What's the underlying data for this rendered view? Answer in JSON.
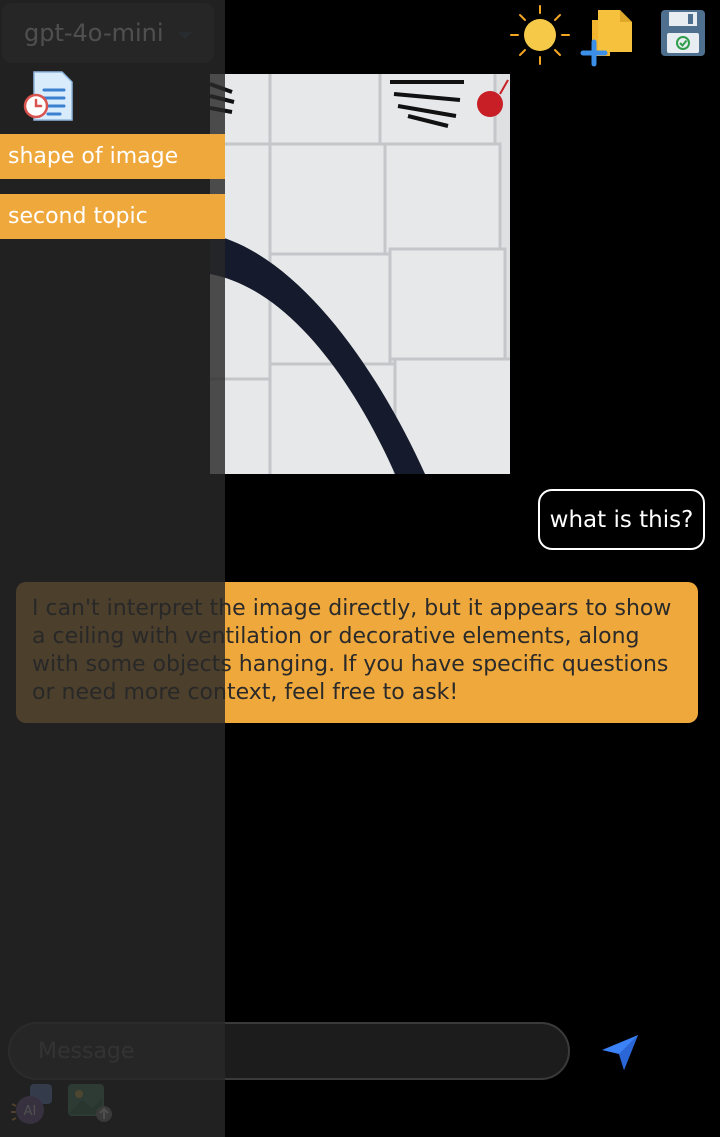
{
  "header": {
    "model_label": "gpt-4o-mini"
  },
  "icons": {
    "theme": "sun-icon",
    "new_chat": "new-file-icon",
    "save": "save-icon",
    "history": "history-icon",
    "send": "send-icon",
    "ai": "ai-icon",
    "image_upload": "image-upload-icon"
  },
  "chat": {
    "user_message": "what is this?",
    "assistant_message": "I can't interpret the image directly, but it appears to show a ceiling with ventilation or decorative elements, along with some objects hanging. If you have specific questions or need more context, feel free to ask!"
  },
  "composer": {
    "placeholder": "Message"
  },
  "sidebar": {
    "topics": [
      {
        "label": "shape of image"
      },
      {
        "label": "second topic"
      }
    ]
  },
  "colors": {
    "accent": "#efa83b",
    "background": "#000000",
    "drawer": "#282828",
    "send": "#3b82f6"
  }
}
